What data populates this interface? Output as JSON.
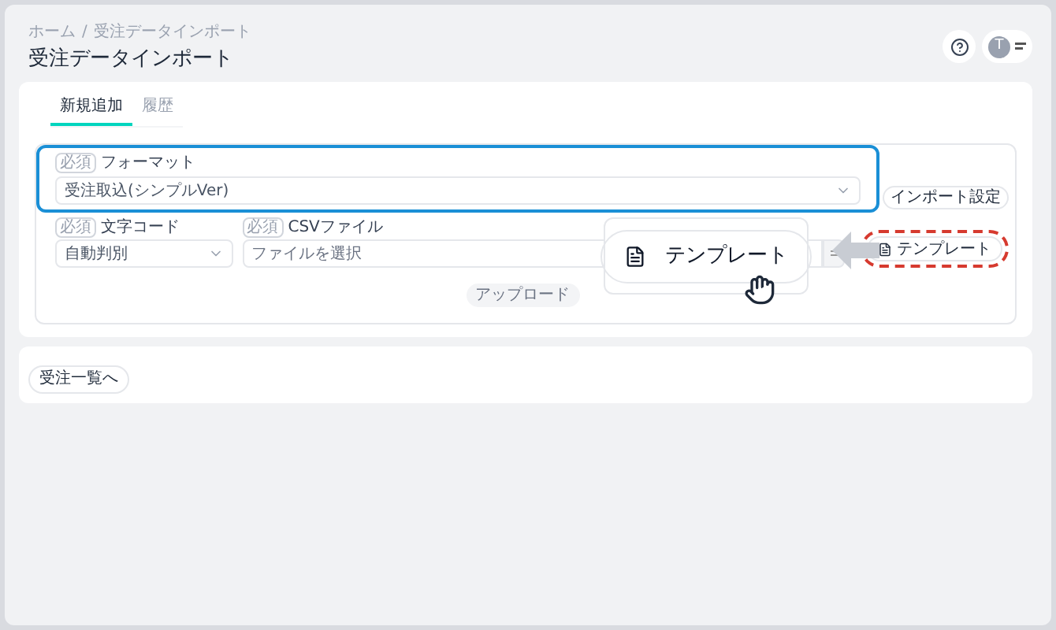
{
  "breadcrumb": [
    "ホーム",
    "/",
    "受注データインポート"
  ],
  "title": "受注データインポート",
  "header": {
    "avatar_initial": "T"
  },
  "tabs": [
    {
      "label": "新規追加",
      "selected": true
    },
    {
      "label": "履歴",
      "selected": false
    }
  ],
  "format": {
    "badge": "必須",
    "label": "フォーマット",
    "value": "受注取込(シンプルVer)",
    "highlighted": true
  },
  "import_settings_button": "インポート設定",
  "charset": {
    "badge": "必須",
    "label": "文字コード",
    "value": "自動判別"
  },
  "csv": {
    "badge": "必須",
    "label": "CSVファイル",
    "placeholder": "ファイルを選択"
  },
  "template_button": {
    "label": "テンプレート",
    "highlighted": true
  },
  "upload_button": {
    "label": "アップロード",
    "disabled": true
  },
  "back_button": "受注一覧へ",
  "callout": {
    "label": "テンプレート"
  }
}
